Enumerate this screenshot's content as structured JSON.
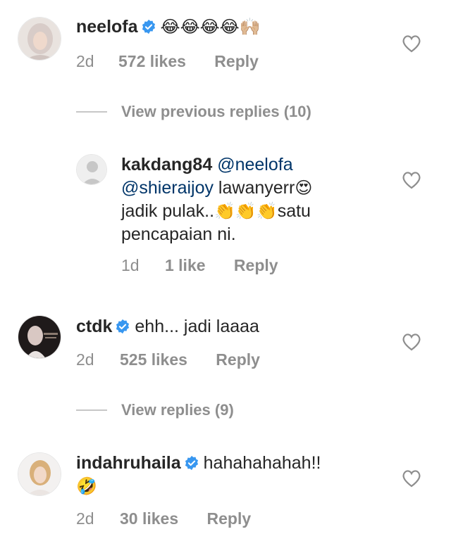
{
  "comments": [
    {
      "username": "neelofa",
      "verified": true,
      "text": "",
      "emojis": "😂😂😂😂🙌🏼",
      "time": "2d",
      "likes": "572 likes",
      "reply": "Reply"
    },
    {
      "username": "kakdang84",
      "verified": false,
      "mention1": "@neelofa",
      "mention2": "@shieraijoy",
      "line2_text": " lawanyerr",
      "line2_emoji": "😍",
      "line3_text": "jadik pulak..",
      "line3_emoji": "👏👏👏",
      "line3_tail": "satu",
      "line4_text": "pencapaian ni.",
      "time": "1d",
      "likes": "1 like",
      "reply": "Reply"
    },
    {
      "username": "ctdk",
      "verified": true,
      "text": "ehh... jadi laaaa",
      "time": "2d",
      "likes": "525 likes",
      "reply": "Reply"
    },
    {
      "username": "indahruhaila",
      "verified": true,
      "text": "hahahahahah!!",
      "emojis": "🤣",
      "time": "2d",
      "likes": "30 likes",
      "reply": "Reply"
    }
  ],
  "view_previous_replies": "View previous replies (10)",
  "view_replies": "View replies (9)",
  "colors": {
    "text": "#262626",
    "meta": "#8e8e8e",
    "verified": "#3897f0",
    "mention": "#003569"
  },
  "icons": {
    "verified": "verified-badge-icon",
    "like": "heart-outline-icon"
  }
}
